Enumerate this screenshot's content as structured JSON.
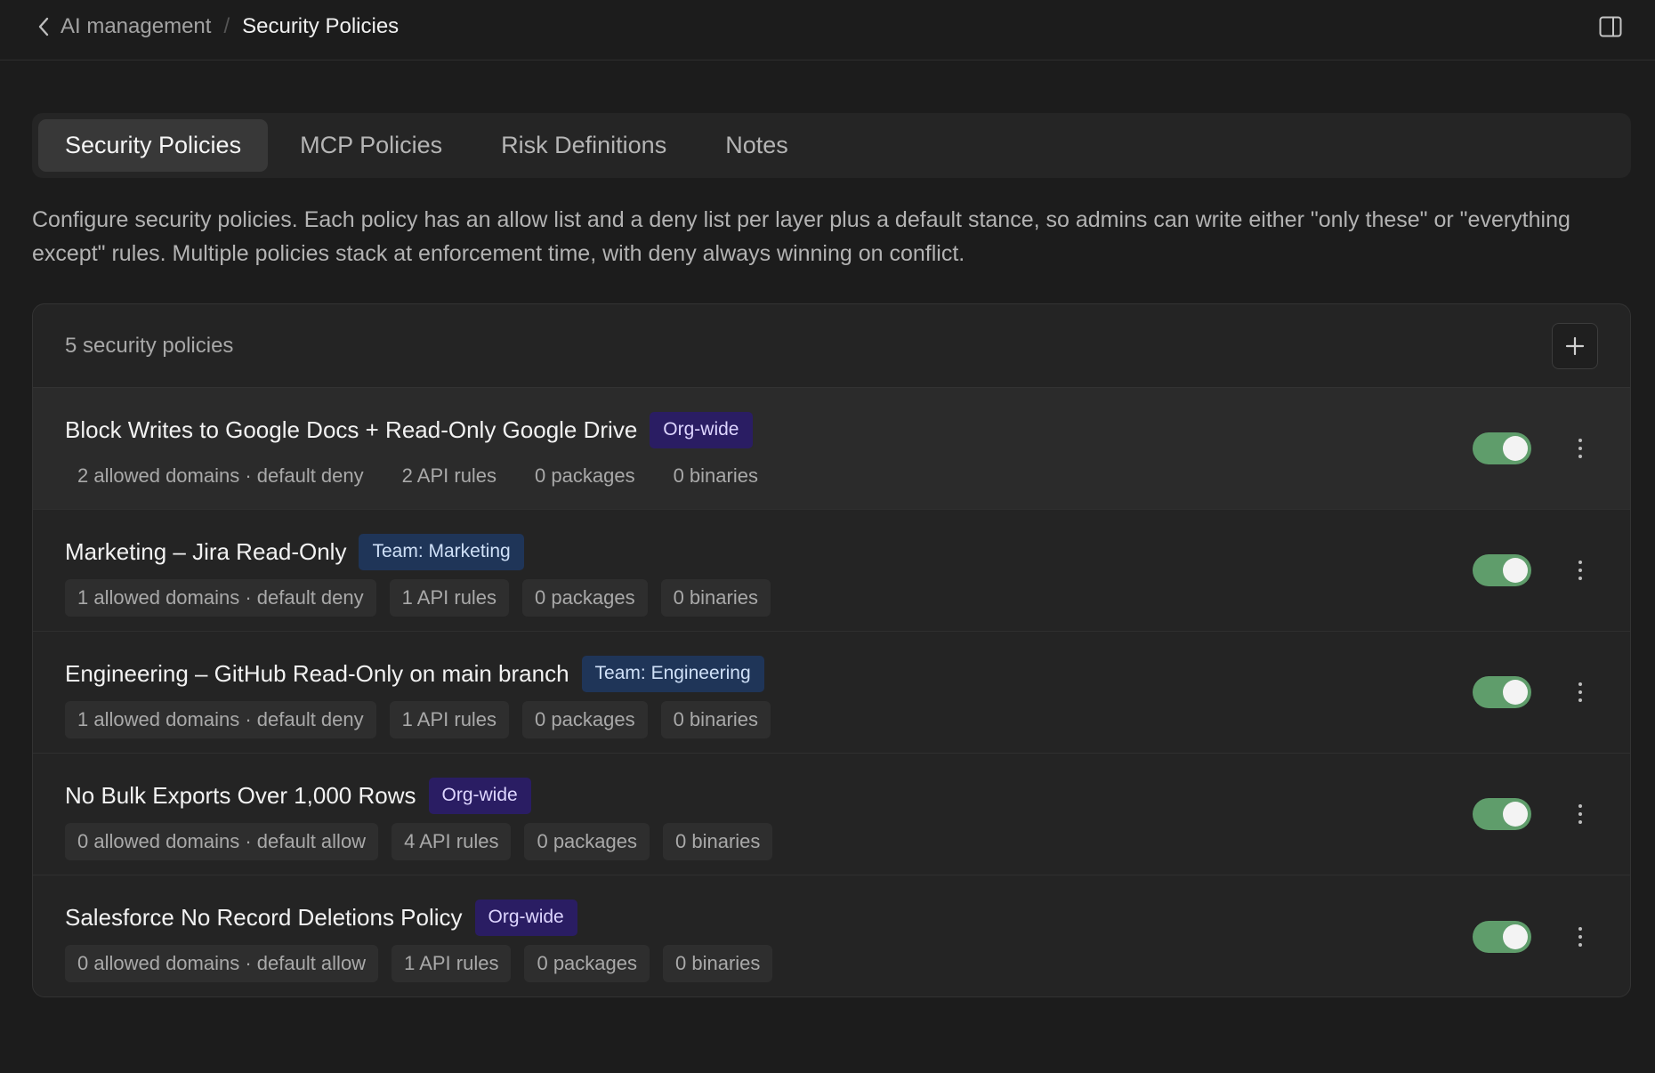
{
  "breadcrumb": {
    "parent": "AI management",
    "separator": "/",
    "current": "Security Policies"
  },
  "icons": {
    "back": "chevron-left-icon",
    "panel": "panel-toggle-icon",
    "add": "plus-icon",
    "menu": "more-vertical-icon"
  },
  "tabs": [
    {
      "label": "Security Policies",
      "active": true
    },
    {
      "label": "MCP Policies",
      "active": false
    },
    {
      "label": "Risk Definitions",
      "active": false
    },
    {
      "label": "Notes",
      "active": false
    }
  ],
  "description": "Configure security policies. Each policy has an allow list and a deny list per layer plus a default stance, so admins can write either \"only these\" or \"everything except\" rules. Multiple policies stack at enforcement time, with deny always winning on conflict.",
  "list": {
    "count_label": "5 security policies"
  },
  "colors": {
    "toggle_on": "#5f9d6b",
    "badge_org": "#2a1d63",
    "badge_team": "#1f3558"
  },
  "policies": [
    {
      "name": "Block Writes to Google Docs + Read-Only Google Drive",
      "scope": "Org-wide",
      "scope_type": "org",
      "chips": [
        "2 allowed domains · default deny",
        "2 API rules",
        "0 packages",
        "0 binaries"
      ],
      "enabled": true,
      "highlighted": true
    },
    {
      "name": "Marketing – Jira Read-Only",
      "scope": "Team: Marketing",
      "scope_type": "team",
      "chips": [
        "1 allowed domains · default deny",
        "1 API rules",
        "0 packages",
        "0 binaries"
      ],
      "enabled": true,
      "highlighted": false
    },
    {
      "name": "Engineering – GitHub Read-Only on main branch",
      "scope": "Team: Engineering",
      "scope_type": "team",
      "chips": [
        "1 allowed domains · default deny",
        "1 API rules",
        "0 packages",
        "0 binaries"
      ],
      "enabled": true,
      "highlighted": false
    },
    {
      "name": "No Bulk Exports Over 1,000 Rows",
      "scope": "Org-wide",
      "scope_type": "org",
      "chips": [
        "0 allowed domains · default allow",
        "4 API rules",
        "0 packages",
        "0 binaries"
      ],
      "enabled": true,
      "highlighted": false
    },
    {
      "name": "Salesforce No Record Deletions Policy",
      "scope": "Org-wide",
      "scope_type": "org",
      "chips": [
        "0 allowed domains · default allow",
        "1 API rules",
        "0 packages",
        "0 binaries"
      ],
      "enabled": true,
      "highlighted": false
    }
  ]
}
